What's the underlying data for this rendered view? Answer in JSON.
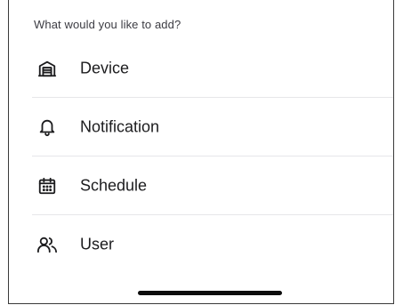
{
  "sheet": {
    "prompt": "What would you like to add?",
    "items": [
      {
        "label": "Device",
        "icon": "garage-icon"
      },
      {
        "label": "Notification",
        "icon": "bell-icon"
      },
      {
        "label": "Schedule",
        "icon": "calendar-icon"
      },
      {
        "label": "User",
        "icon": "users-icon"
      }
    ]
  }
}
